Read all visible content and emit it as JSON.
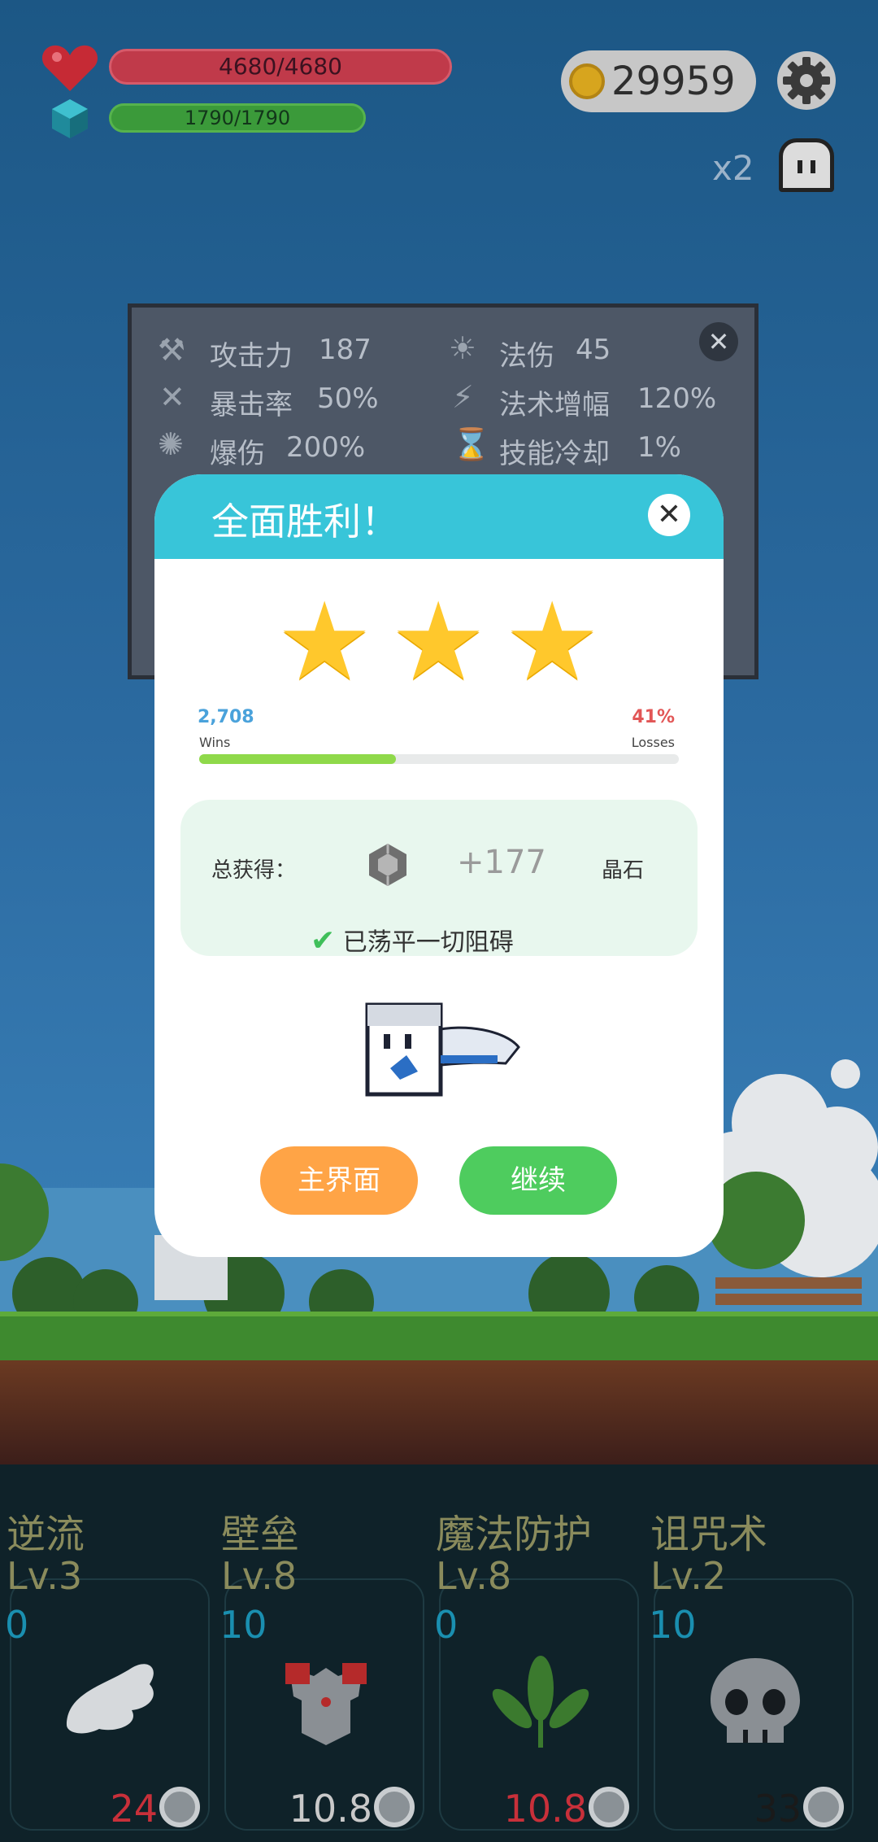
{
  "hud": {
    "hp": "4680/4680",
    "mp": "1790/1790",
    "gold": "29959",
    "speed": "x2",
    "gear_icon": "gear-icon",
    "hp_icon": "heart-icon",
    "mp_icon": "crystal-icon"
  },
  "stats_panel": {
    "items": [
      {
        "icon": "axe-icon",
        "label": "攻击力",
        "value": "187"
      },
      {
        "icon": "sun-icon",
        "label": "法伤",
        "value": "45"
      },
      {
        "icon": "crossed-swords-icon",
        "label": "暴击率",
        "value": "50%"
      },
      {
        "icon": "lightning-icon",
        "label": "法术增幅",
        "value": "120%"
      },
      {
        "icon": "burst-icon",
        "label": "爆伤",
        "value": "200%"
      },
      {
        "icon": "hourglass-icon",
        "label": "技能冷却",
        "value": "1%"
      }
    ],
    "close_icon": "close-icon"
  },
  "modal": {
    "title": "全面胜利！",
    "stars": 3,
    "wins_count": "2,708",
    "wins_label": "Wins",
    "losses_pct": "41%",
    "losses_label": "Losses",
    "win_fraction": 0.41,
    "reward_label": "总获得：",
    "reward_value": "+177",
    "reward_unit": "晶石",
    "clear_text": "已荡平一切阻碍",
    "home_button": "主界面",
    "continue_button": "继续"
  },
  "skills": [
    {
      "name": "逆流",
      "level": "Lv.3",
      "points": "0",
      "cost": "24",
      "cost_color": "#c8303a",
      "icon": "wing-icon"
    },
    {
      "name": "壁垒",
      "level": "Lv.8",
      "points": "10",
      "cost": "10.8",
      "cost_color": "#c9c9c9",
      "icon": "armor-icon"
    },
    {
      "name": "魔法防护",
      "level": "Lv.8",
      "points": "0",
      "cost": "10.8",
      "cost_color": "#c8303a",
      "icon": "leaf-icon"
    },
    {
      "name": "诅咒术",
      "level": "Lv.2",
      "points": "10",
      "cost": "33",
      "cost_color": "#1a1a1a",
      "icon": "skull-icon"
    }
  ],
  "colors": {
    "accent_teal": "#38c5d9",
    "button_orange": "#ffa446",
    "button_green": "#4ecc5e",
    "star_gold": "#ffc82c"
  }
}
